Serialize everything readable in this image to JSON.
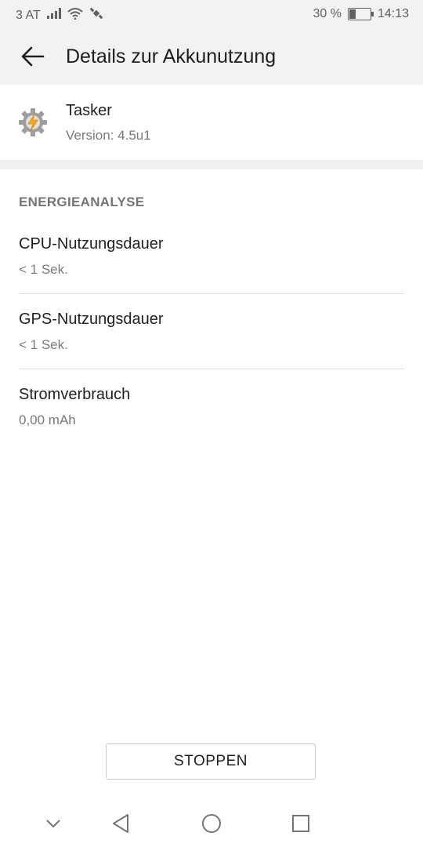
{
  "status_bar": {
    "carrier": "3 AT",
    "battery_percent": "30 %",
    "battery_level": 0.3,
    "time": "14:13",
    "icons": [
      "signal-icon",
      "wifi-icon",
      "satellite-icon",
      "battery-charging-icon"
    ]
  },
  "app_bar": {
    "title": "Details zur Akkunutzung",
    "back_icon": "arrow-back-icon"
  },
  "app_info": {
    "name": "Tasker",
    "version": "Version: 4.5u1",
    "icon": "tasker-gear-icon"
  },
  "energy_analysis": {
    "header": "ENERGIEANALYSE",
    "items": [
      {
        "title": "CPU-Nutzungsdauer",
        "value": "< 1 Sek."
      },
      {
        "title": "GPS-Nutzungsdauer",
        "value": "< 1 Sek."
      },
      {
        "title": "Stromverbrauch",
        "value": "0,00 mAh"
      }
    ]
  },
  "actions": {
    "stop_label": "STOPPEN"
  },
  "nav_bar": {
    "items": [
      "chevron-down-icon",
      "back-triangle-icon",
      "home-circle-icon",
      "recents-square-icon"
    ]
  }
}
